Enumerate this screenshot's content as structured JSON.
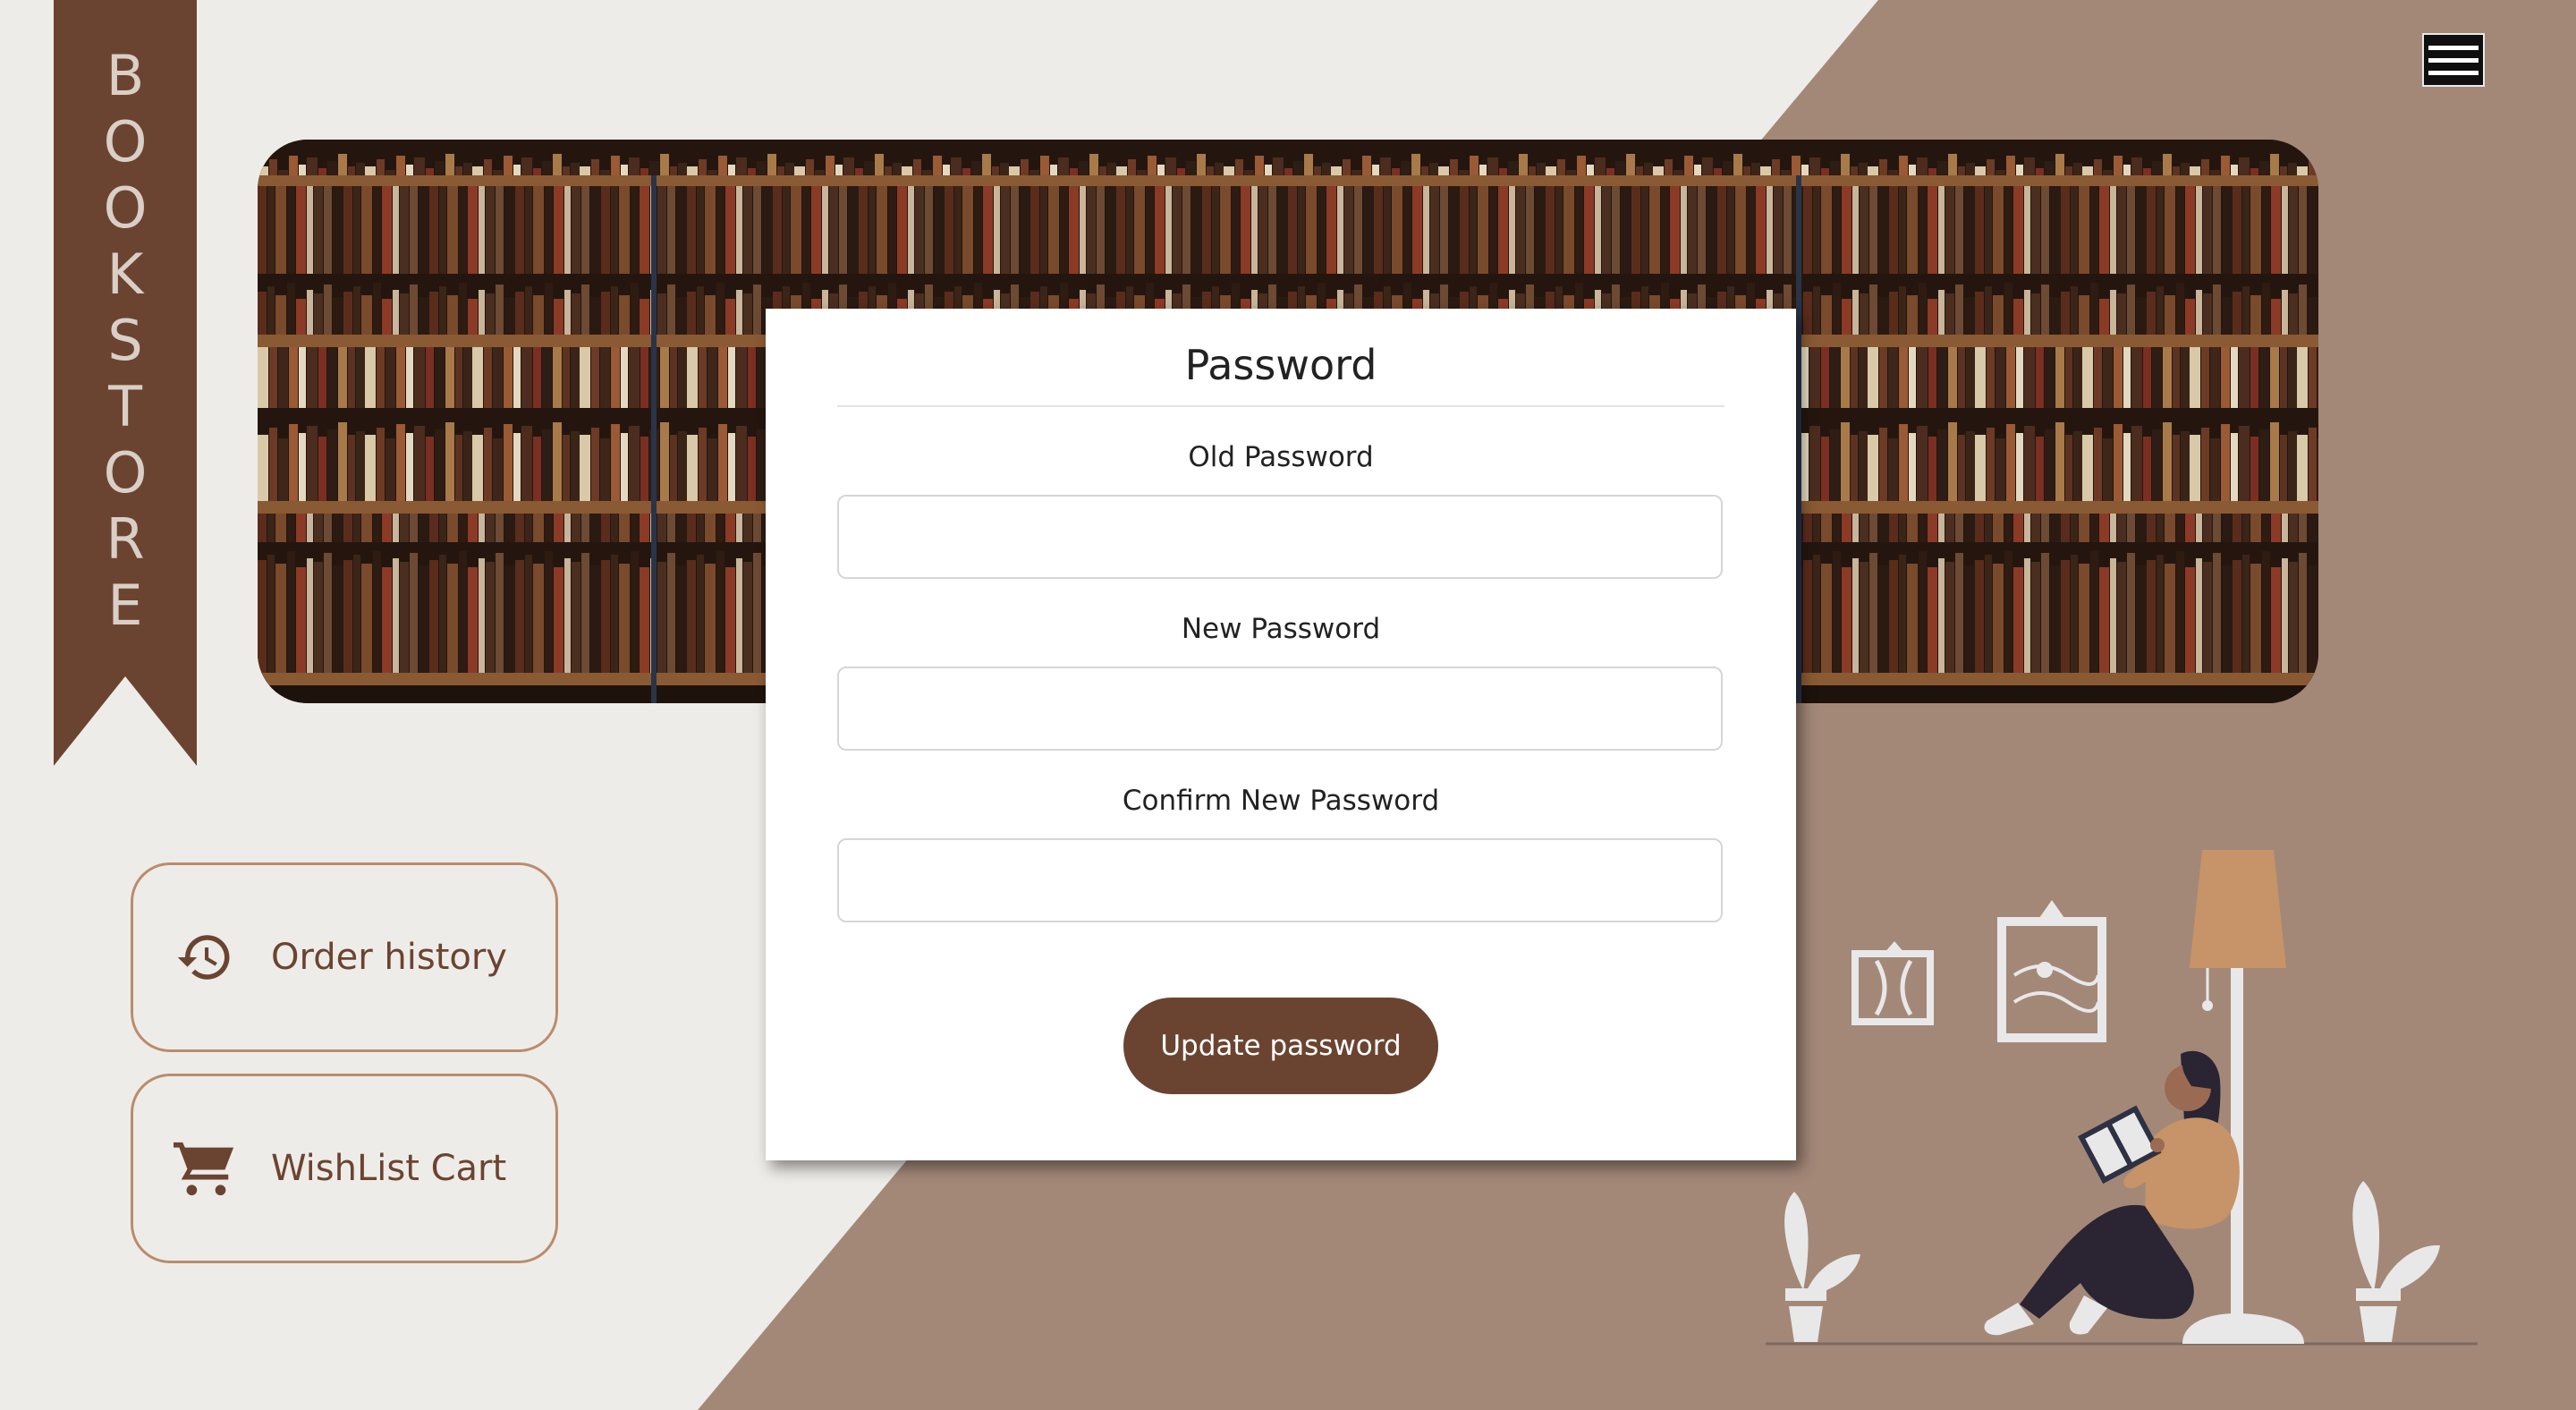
{
  "brand": {
    "letters": [
      "B",
      "O",
      "O",
      "K",
      "S",
      "T",
      "O",
      "R",
      "E"
    ]
  },
  "colors": {
    "accent": "#6b4431",
    "ribbon": "#6b4431",
    "diag": "#a38878",
    "bg": "#eeece8",
    "btn_border": "#b98c6e"
  },
  "header": {
    "menu_icon": "hamburger-icon"
  },
  "form": {
    "title": "Password",
    "fields": [
      {
        "label": "Old Password",
        "value": ""
      },
      {
        "label": "New Password",
        "value": ""
      },
      {
        "label": "Confirm New Password",
        "value": ""
      }
    ],
    "submit_label": "Update password"
  },
  "sidebar": {
    "items": [
      {
        "label": "Order history",
        "icon": "history-icon"
      },
      {
        "label": "WishList Cart",
        "icon": "cart-icon"
      }
    ]
  }
}
